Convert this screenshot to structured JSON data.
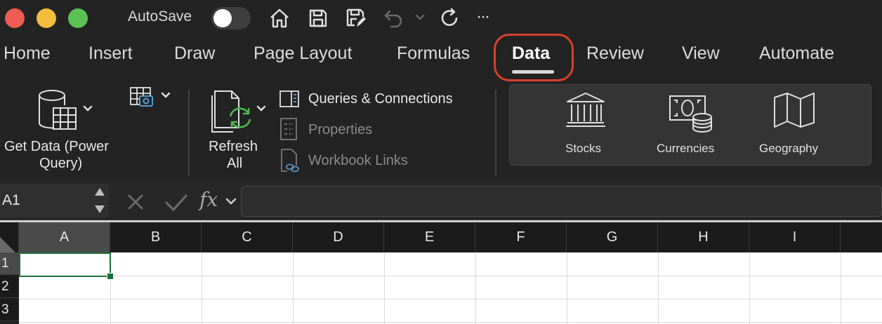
{
  "titlebar": {
    "autosave_label": "AutoSave",
    "autosave_on": false,
    "icons": [
      "home-icon",
      "save-icon",
      "save-as-icon",
      "undo-icon",
      "redo-icon",
      "more-icon"
    ],
    "more_glyph": "···"
  },
  "tabs": [
    {
      "label": "Home"
    },
    {
      "label": "Insert"
    },
    {
      "label": "Draw"
    },
    {
      "label": "Page Layout"
    },
    {
      "label": "Formulas"
    },
    {
      "label": "Data",
      "active": true
    },
    {
      "label": "Review"
    },
    {
      "label": "View"
    },
    {
      "label": "Automate"
    }
  ],
  "ribbon": {
    "get_data_line1": "Get Data (Power",
    "get_data_line2": "Query)",
    "refresh_line1": "Refresh",
    "refresh_line2": "All",
    "queries_connections": "Queries & Connections",
    "properties": "Properties",
    "workbook_links": "Workbook Links",
    "data_types": {
      "stocks": "Stocks",
      "currencies": "Currencies",
      "geography": "Geography"
    }
  },
  "formula_bar": {
    "name_box": "A1",
    "fx": "fx",
    "formula": ""
  },
  "grid": {
    "columns": [
      "A",
      "B",
      "C",
      "D",
      "E",
      "F",
      "G",
      "H",
      "I"
    ],
    "rows": [
      "1",
      "2",
      "3"
    ],
    "selected_cell": "A1"
  },
  "colors": {
    "highlight": "#d8402b",
    "selection": "#1e6f3d",
    "refresh_green": "#4fb84f"
  }
}
